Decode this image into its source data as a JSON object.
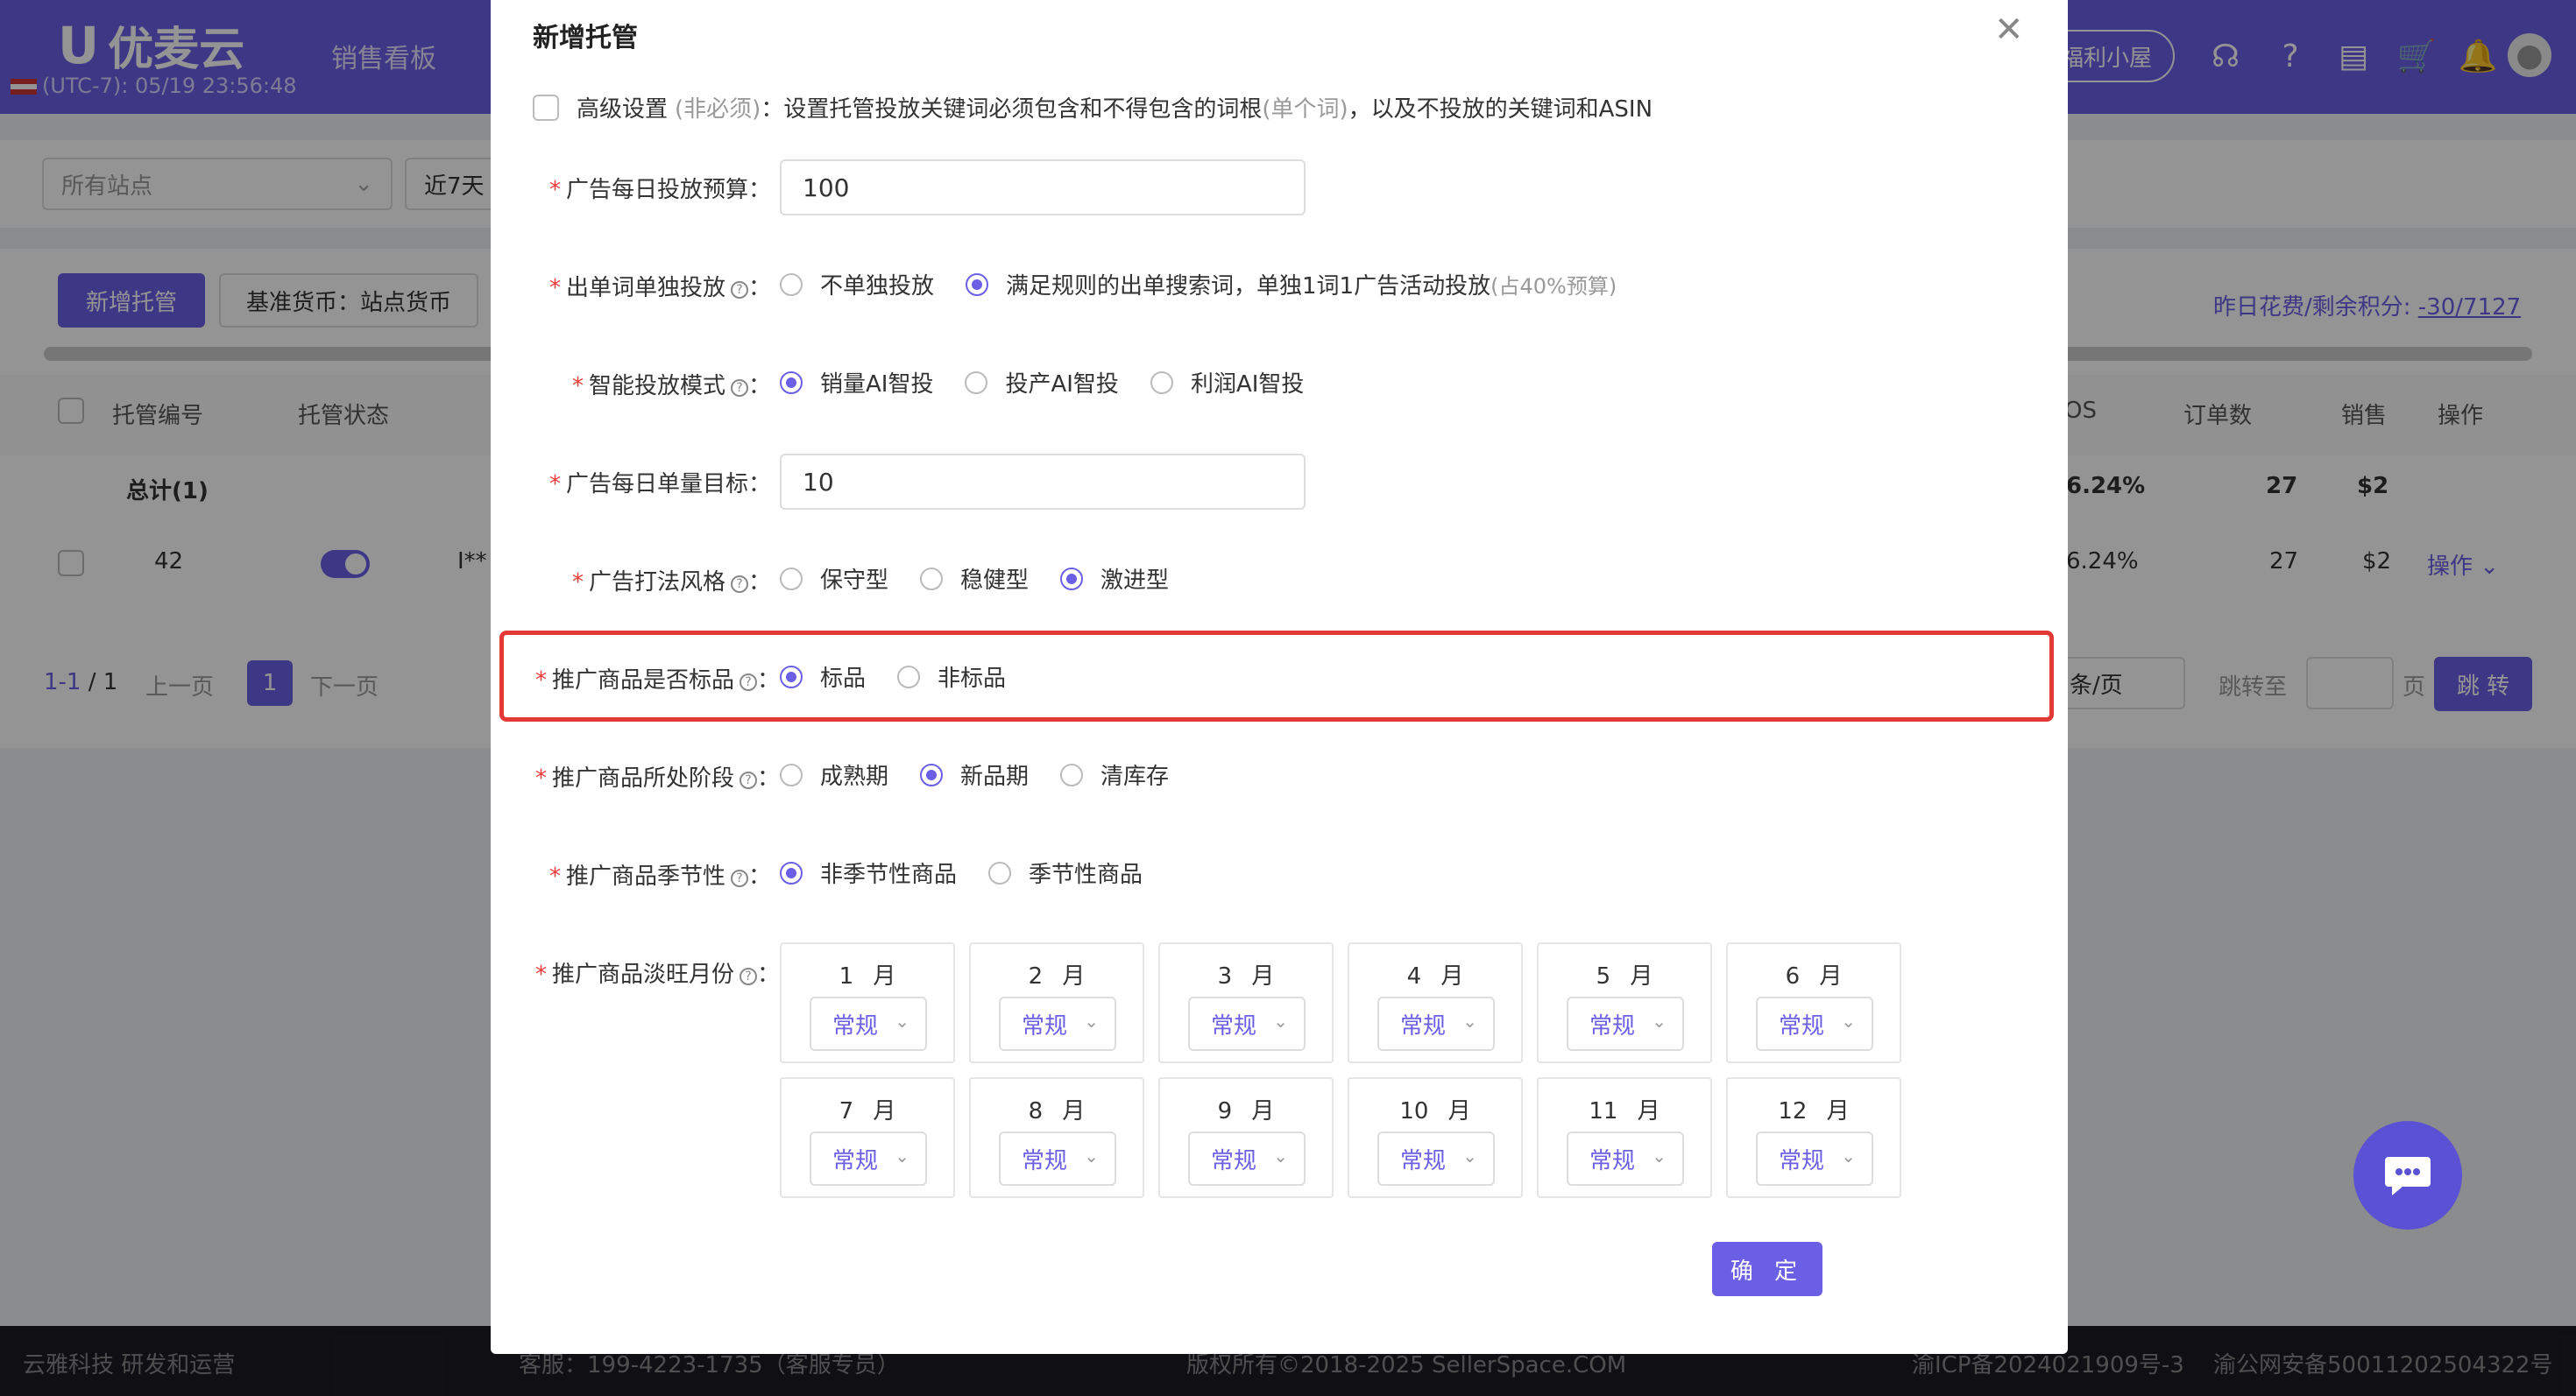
{
  "topbar": {
    "logo": "优麦云",
    "clock": "(UTC-7): 05/19 23:56:48",
    "nav_sales_board": "销售看板",
    "welfare": "福利小屋"
  },
  "filters": {
    "site_placeholder": "所有站点",
    "date_range": "近7天"
  },
  "toolbar": {
    "new_button": "新增托管",
    "currency_button": "基准货币：站点货币",
    "cost_label": "昨日花费/剩余积分:",
    "cost_value": "-30/7127"
  },
  "table": {
    "headers": {
      "id": "托管编号",
      "status": "托管状态",
      "acos": "OS",
      "orders": "订单数",
      "sales": "销售",
      "ops": "操作"
    },
    "total_label": "总计(1)",
    "total_acos": "6.24%",
    "total_orders": "27",
    "total_sales": "$2",
    "row": {
      "id": "42",
      "name": "I**",
      "acos": "6.24%",
      "orders": "27",
      "sales": "$2",
      "ops": "操作"
    }
  },
  "pagination": {
    "range": "1-1",
    "total": "/ 1",
    "prev": "上一页",
    "current": "1",
    "next": "下一页",
    "per_page": "条/页",
    "jump_to": "跳转至",
    "page_unit": "页",
    "jump_button": "跳 转"
  },
  "footer": {
    "company": "云雅科技 研发和运营",
    "service": "客服：199-4223-1735（客服专员）",
    "copyright": "版权所有©2018-2025 SellerSpace.COM",
    "icp": "渝ICP备2024021909号-3",
    "police": "渝公网安备50011202504322号"
  },
  "modal": {
    "title": "新增托管",
    "advanced": {
      "label": "高级设置",
      "optional": "(非必须)",
      "desc": "：设置托管投放关键词必须包含和不得包含的词根",
      "single_word": "(单个词)",
      "desc2": "，以及不投放的关键词和ASIN"
    },
    "budget": {
      "label": "广告每日投放预算：",
      "value": "100"
    },
    "single_launch": {
      "label": "出单词单独投放",
      "colon": "：",
      "options": [
        "不单独投放",
        "满足规则的出单搜索词，单独1词1广告活动投放"
      ],
      "note": "(占40%预算)",
      "selected": 1
    },
    "ai_mode": {
      "label": "智能投放模式",
      "colon": "：",
      "options": [
        "销量AI智投",
        "投产AI智投",
        "利润AI智投"
      ],
      "selected": 0
    },
    "daily_orders": {
      "label": "广告每日单量目标：",
      "value": "10"
    },
    "style": {
      "label": "广告打法风格",
      "colon": "：",
      "options": [
        "保守型",
        "稳健型",
        "激进型"
      ],
      "selected": 2
    },
    "standard": {
      "label": "推广商品是否标品",
      "colon": "：",
      "options": [
        "标品",
        "非标品"
      ],
      "selected": 0
    },
    "stage": {
      "label": "推广商品所处阶段",
      "colon": "：",
      "options": [
        "成熟期",
        "新品期",
        "清库存"
      ],
      "selected": 1
    },
    "season": {
      "label": "推广商品季节性",
      "colon": "：",
      "options": [
        "非季节性商品",
        "季节性商品"
      ],
      "selected": 0
    },
    "months": {
      "label": "推广商品淡旺月份",
      "colon": "：",
      "items": [
        {
          "month": "1 月",
          "value": "常规"
        },
        {
          "month": "2 月",
          "value": "常规"
        },
        {
          "month": "3 月",
          "value": "常规"
        },
        {
          "month": "4 月",
          "value": "常规"
        },
        {
          "month": "5 月",
          "value": "常规"
        },
        {
          "month": "6 月",
          "value": "常规"
        },
        {
          "month": "7 月",
          "value": "常规"
        },
        {
          "month": "8 月",
          "value": "常规"
        },
        {
          "month": "9 月",
          "value": "常规"
        },
        {
          "month": "10 月",
          "value": "常规"
        },
        {
          "month": "11 月",
          "value": "常规"
        },
        {
          "month": "12 月",
          "value": "常规"
        }
      ]
    },
    "confirm": "确 定"
  },
  "colors": {
    "accent": "#6b5fe6",
    "highlight": "#e53935"
  }
}
